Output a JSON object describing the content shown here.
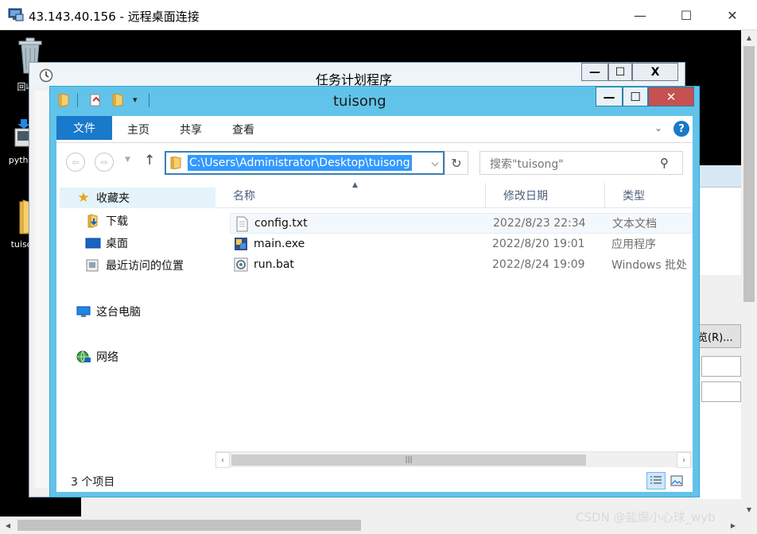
{
  "rdp": {
    "title": "43.143.40.156 - 远程桌面连接",
    "minimize_glyph": "—",
    "maximize_glyph": "☐",
    "close_glyph": "✕"
  },
  "desktop": {
    "icons": [
      {
        "label": "回收站",
        "icon": "recycle-bin-icon"
      },
      {
        "label": "python",
        "icon": "python-installer-icon"
      },
      {
        "label": "tuisong",
        "icon": "folder-icon"
      }
    ]
  },
  "task_scheduler": {
    "title": "任务计划程序",
    "minimize_glyph": "—",
    "maximize_glyph": "☐",
    "close_glyph": "X",
    "browse_button": "览(R)..."
  },
  "explorer": {
    "title": "tuisong",
    "minimize_glyph": "—",
    "maximize_glyph": "☐",
    "close_glyph": "✕",
    "ribbon_tabs": [
      "文件",
      "主页",
      "共享",
      "查看"
    ],
    "address": "C:\\Users\\Administrator\\Desktop\\tuisong",
    "search_placeholder": "搜索\"tuisong\"",
    "nav": {
      "favorites": "收藏夹",
      "downloads": "下载",
      "desktop": "桌面",
      "recent": "最近访问的位置",
      "this_pc": "这台电脑",
      "network": "网络"
    },
    "columns": [
      "名称",
      "修改日期",
      "类型"
    ],
    "files": [
      {
        "name": "config.txt",
        "date": "2022/8/23 22:34",
        "type": "文本文档",
        "icon": "text-file-icon"
      },
      {
        "name": "main.exe",
        "date": "2022/8/20 19:01",
        "type": "应用程序",
        "icon": "executable-icon"
      },
      {
        "name": "run.bat",
        "date": "2022/8/24 19:09",
        "type": "Windows 批处",
        "icon": "batch-file-icon"
      }
    ],
    "status_count": "3 个项目"
  },
  "watermark": "CSDN @盐焗小心球_wyb",
  "colors": {
    "explorer_frame": "#62c3ea",
    "ribbon_file_tab": "#1979ca",
    "selection": "#3399ff",
    "close_red": "#c75050"
  }
}
